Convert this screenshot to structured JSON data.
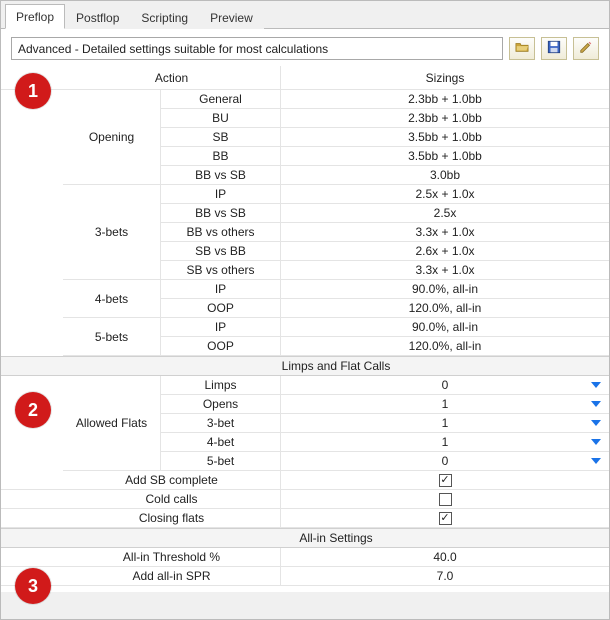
{
  "tabs": [
    "Preflop",
    "Postflop",
    "Scripting",
    "Preview"
  ],
  "active_tab_index": 0,
  "profile_select": {
    "value": "Advanced - Detailed settings suitable for most calculations"
  },
  "badges": {
    "one": "1",
    "two": "2",
    "three": "3"
  },
  "header": {
    "action": "Action",
    "sizings": "Sizings"
  },
  "section1": {
    "groups": [
      {
        "label": "Opening",
        "rows": [
          {
            "sub": "General",
            "val": "2.3bb + 1.0bb"
          },
          {
            "sub": "BU",
            "val": "2.3bb + 1.0bb"
          },
          {
            "sub": "SB",
            "val": "3.5bb + 1.0bb"
          },
          {
            "sub": "BB",
            "val": "3.5bb + 1.0bb"
          },
          {
            "sub": "BB vs SB",
            "val": "3.0bb"
          }
        ]
      },
      {
        "label": "3-bets",
        "rows": [
          {
            "sub": "IP",
            "val": "2.5x + 1.0x"
          },
          {
            "sub": "BB vs SB",
            "val": "2.5x"
          },
          {
            "sub": "BB vs others",
            "val": "3.3x + 1.0x"
          },
          {
            "sub": "SB vs BB",
            "val": "2.6x + 1.0x"
          },
          {
            "sub": "SB vs others",
            "val": "3.3x + 1.0x"
          }
        ]
      },
      {
        "label": "4-bets",
        "rows": [
          {
            "sub": "IP",
            "val": "90.0%, all-in"
          },
          {
            "sub": "OOP",
            "val": "120.0%, all-in"
          }
        ]
      },
      {
        "label": "5-bets",
        "rows": [
          {
            "sub": "IP",
            "val": "90.0%, all-in"
          },
          {
            "sub": "OOP",
            "val": "120.0%, all-in"
          }
        ]
      }
    ]
  },
  "section2": {
    "title": "Limps and Flat Calls",
    "group_label": "Allowed Flats",
    "rows": [
      {
        "sub": "Limps",
        "val": "0"
      },
      {
        "sub": "Opens",
        "val": "1"
      },
      {
        "sub": "3-bet",
        "val": "1"
      },
      {
        "sub": "4-bet",
        "val": "1"
      },
      {
        "sub": "5-bet",
        "val": "0"
      }
    ],
    "checks": [
      {
        "label": "Add SB complete",
        "checked": true
      },
      {
        "label": "Cold calls",
        "checked": false
      },
      {
        "label": "Closing flats",
        "checked": true
      }
    ]
  },
  "section3": {
    "title": "All-in Settings",
    "rows": [
      {
        "label": "All-in Threshold %",
        "val": "40.0"
      },
      {
        "label": "Add all-in SPR",
        "val": "7.0"
      }
    ]
  },
  "icons": {
    "open": "open-folder",
    "save": "save-disk",
    "edit": "edit-pencil"
  }
}
